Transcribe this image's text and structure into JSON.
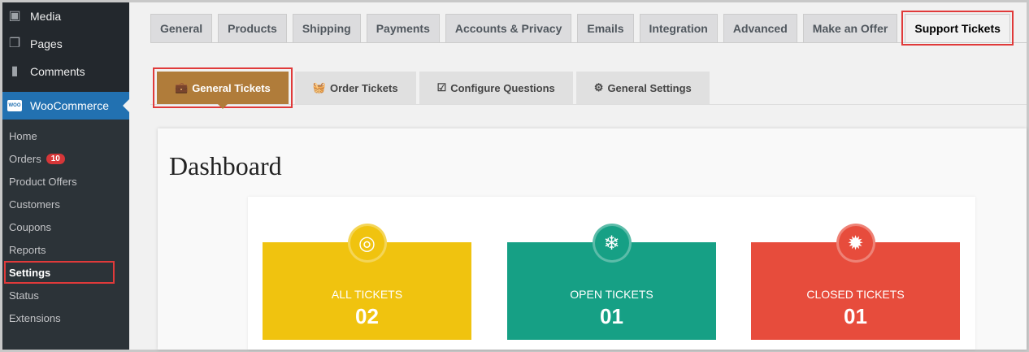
{
  "sidebar": {
    "top": [
      {
        "label": "Media",
        "icon": "media-icon"
      },
      {
        "label": "Pages",
        "icon": "pages-icon"
      },
      {
        "label": "Comments",
        "icon": "comments-icon"
      }
    ],
    "woocommerce": {
      "label": "WooCommerce",
      "logo": "Woo"
    },
    "submenu": [
      "Home",
      "Orders",
      "Product Offers",
      "Customers",
      "Coupons",
      "Reports",
      "Settings",
      "Status",
      "Extensions"
    ],
    "orders_badge": "10"
  },
  "tabs": [
    "General",
    "Products",
    "Shipping",
    "Payments",
    "Accounts & Privacy",
    "Emails",
    "Integration",
    "Advanced",
    "Make an Offer",
    "Support Tickets"
  ],
  "subtabs": [
    "General Tickets",
    "Order Tickets",
    "Configure Questions",
    "General Settings"
  ],
  "dashboard": {
    "title": "Dashboard",
    "boxes": [
      {
        "label": "ALL TICKETS",
        "value": "02",
        "color": "#f0c30f",
        "icon": "target-icon"
      },
      {
        "label": "OPEN TICKETS",
        "value": "01",
        "color": "#16a085",
        "icon": "snowflake-icon"
      },
      {
        "label": "CLOSED TICKETS",
        "value": "01",
        "color": "#e74c3c",
        "icon": "certificate-icon"
      }
    ]
  }
}
